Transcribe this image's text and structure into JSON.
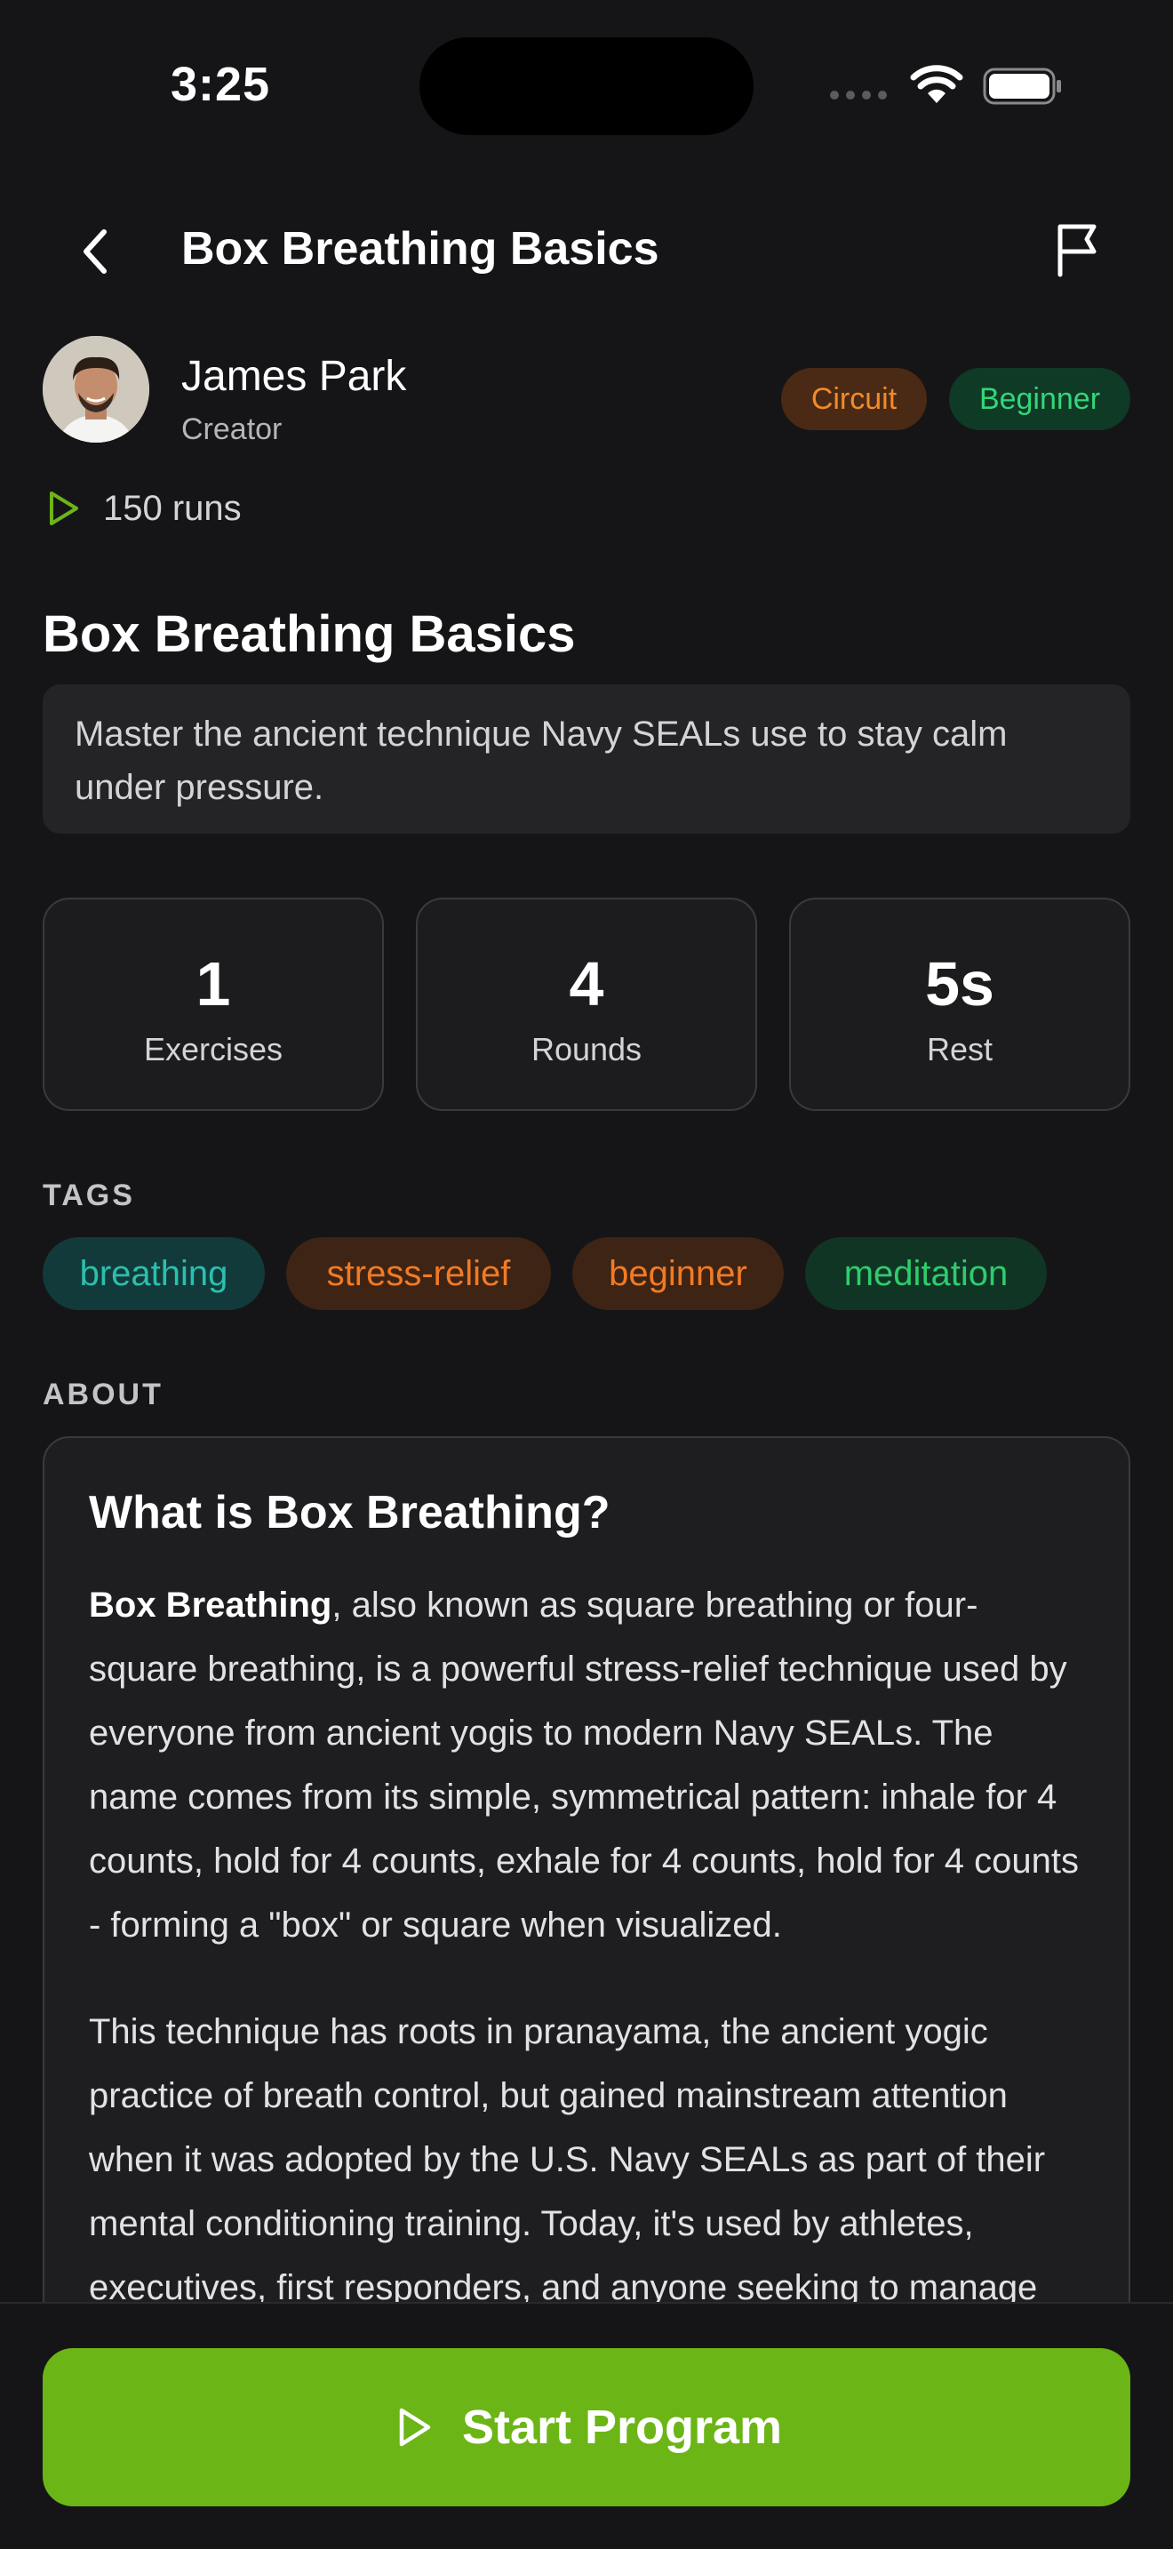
{
  "status_bar": {
    "time": "3:25"
  },
  "nav": {
    "title": "Box Breathing Basics"
  },
  "creator": {
    "name": "James Park",
    "role": "Creator"
  },
  "badges": {
    "type": "Circuit",
    "level": "Beginner"
  },
  "runs": "150 runs",
  "program": {
    "title": "Box Breathing Basics",
    "description": "Master the ancient technique Navy SEALs use to stay calm under pressure."
  },
  "stats": [
    {
      "value": "1",
      "label": "Exercises"
    },
    {
      "value": "4",
      "label": "Rounds"
    },
    {
      "value": "5s",
      "label": "Rest"
    }
  ],
  "tags_heading": "TAGS",
  "tags": [
    "breathing",
    "stress-relief",
    "beginner",
    "meditation"
  ],
  "about_heading": "ABOUT",
  "about": {
    "heading": "What is Box Breathing?",
    "p1_bold": "Box Breathing",
    "p1_rest": ", also known as square breathing or four-square breathing, is a powerful stress-relief technique used by everyone from ancient yogis to modern Navy SEALs. The name comes from its simple, symmetrical pattern: inhale for 4 counts, hold for 4 counts, exhale for 4 counts, hold for 4 counts - forming a \"box\" or square when visualized.",
    "p2": "This technique has roots in pranayama, the ancient yogic practice of breath control, but gained mainstream attention when it was adopted by the U.S. Navy SEALs as part of their mental conditioning training. Today, it's used by athletes, executives, first responders, and anyone seeking to manage"
  },
  "cta": {
    "label": "Start Program"
  },
  "colors": {
    "background": "#151517",
    "accent_green": "#6cb517",
    "circuit_orange": "#f28a2a",
    "beginner_green": "#34d67a",
    "tag_teal": "#2bbfae"
  }
}
